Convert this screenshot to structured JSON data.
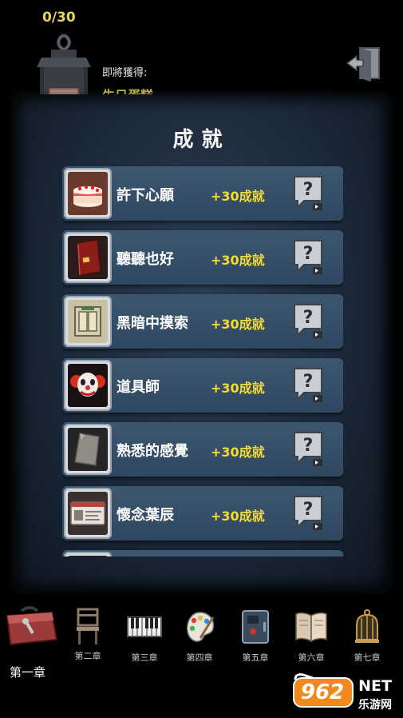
{
  "header": {
    "progress": "0/30",
    "reward_label": "即將獲得:",
    "reward_name": "生日蛋糕"
  },
  "panel": {
    "title": "成就"
  },
  "achievements": [
    {
      "name": "許下心願",
      "points": "+30成就",
      "icon": "birthday-cake-icon"
    },
    {
      "name": "聽聽也好",
      "points": "+30成就",
      "icon": "red-book-icon"
    },
    {
      "name": "黑暗中摸索",
      "points": "+30成就",
      "icon": "light-switch-icon"
    },
    {
      "name": "道具師",
      "points": "+30成就",
      "icon": "clown-icon"
    },
    {
      "name": "熟悉的感覺",
      "points": "+30成就",
      "icon": "paper-icon"
    },
    {
      "name": "懷念葉辰",
      "points": "+30成就",
      "icon": "id-card-icon"
    }
  ],
  "chapters": [
    {
      "label": "第一章",
      "icon": "toolbox-icon"
    },
    {
      "label": "第二章",
      "icon": "chair-icon"
    },
    {
      "label": "第三章",
      "icon": "piano-keys-icon"
    },
    {
      "label": "第四章",
      "icon": "palette-icon"
    },
    {
      "label": "第五章",
      "icon": "safe-icon"
    },
    {
      "label": "第六章",
      "icon": "open-book-icon"
    },
    {
      "label": "第七章",
      "icon": "birdcage-icon"
    }
  ],
  "watermark": {
    "brand": "962",
    "suffix": "NET",
    "subtitle": "乐游网"
  },
  "colors": {
    "accent_yellow": "#f0dc36",
    "panel_bg": "#1b2838",
    "row_bg": "#3d5770"
  }
}
